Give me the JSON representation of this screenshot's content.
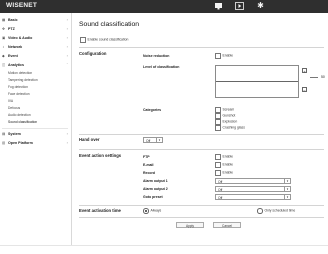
{
  "header": {
    "logo": "WISENET",
    "icons": [
      "monitor-icon",
      "play-icon",
      "gear-icon"
    ]
  },
  "sidebar": {
    "items": [
      {
        "label": "Basic",
        "icon": "grid-icon"
      },
      {
        "label": "PTZ",
        "icon": "ptz-icon"
      },
      {
        "label": "Video & Audio",
        "icon": "camera-icon"
      },
      {
        "label": "Network",
        "icon": "network-icon"
      },
      {
        "label": "Event",
        "icon": "bell-icon"
      },
      {
        "label": "Analytics",
        "icon": "analytics-icon"
      }
    ],
    "analytics_subitems": [
      "Motion detection",
      "Tampering detection",
      "Fog detection",
      "Face detection",
      "IVA",
      "Defocus",
      "Audio detection",
      "Sound classification"
    ],
    "bottom_items": [
      {
        "label": "System",
        "icon": "system-icon"
      },
      {
        "label": "Open Platform",
        "icon": "platform-icon"
      }
    ]
  },
  "page": {
    "title": "Sound classification",
    "enable_label": "Enable sound classification"
  },
  "configuration": {
    "section_label": "Configuration",
    "noise_reduction_label": "Noise reduction",
    "noise_reduction_option": "Enable",
    "level_label": "Level of classification",
    "level_value": "50",
    "categories_label": "Categories",
    "categories": [
      "Scream",
      "Gunshot",
      "Explosion",
      "Crashing glass"
    ]
  },
  "hand_over": {
    "label": "Hand over",
    "value": "Off"
  },
  "event_action": {
    "section_label": "Event action settings",
    "ftp_label": "FTP",
    "ftp_option": "Enable",
    "email_label": "E-mail",
    "email_option": "Enable",
    "record_label": "Record",
    "record_option": "Enable",
    "alarm1_label": "Alarm output 1",
    "alarm1_value": "Off",
    "alarm2_label": "Alarm output 2",
    "alarm2_value": "Off",
    "goto_label": "Goto preset",
    "goto_value": "Off"
  },
  "activation": {
    "section_label": "Event activation time",
    "always_label": "Always",
    "scheduled_label": "Only scheduled time"
  },
  "buttons": {
    "apply": "Apply",
    "cancel": "Cancel"
  }
}
